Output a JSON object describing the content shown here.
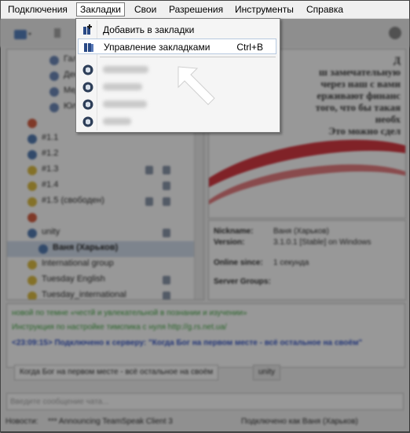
{
  "menubar": {
    "items": [
      {
        "label": "Подключения"
      },
      {
        "label": "Закладки"
      },
      {
        "label": "Свои"
      },
      {
        "label": "Разрешения"
      },
      {
        "label": "Инструменты"
      },
      {
        "label": "Справка"
      }
    ]
  },
  "bookmarks_menu": {
    "add_label": "Добавить в закладки",
    "manage_label": "Управление закладками",
    "manage_shortcut": "Ctrl+B"
  },
  "tree": {
    "rows": [
      {
        "label": "Гал"
      },
      {
        "label": "Ден"
      },
      {
        "label": "Мед"
      },
      {
        "label": "Юли"
      },
      {
        "label": ""
      },
      {
        "label": "#1.1"
      },
      {
        "label": "#1.2"
      },
      {
        "label": "#1.3"
      },
      {
        "label": "#1.4"
      },
      {
        "label": "#1.5 (свободен)"
      },
      {
        "label": ""
      },
      {
        "label": "unity"
      },
      {
        "label": "Ваня (Харьков)"
      },
      {
        "label": "International group"
      },
      {
        "label": "Tuesday English"
      },
      {
        "label": "Tuesday_international"
      }
    ]
  },
  "banner": {
    "lines": [
      "Д",
      "ш замечательную",
      "через наш с вами",
      "ерживают финанс",
      "того, что бы такая",
      "необх",
      "Это можно сдел"
    ]
  },
  "info": {
    "nickname_label": "Nickname:",
    "nickname_value": "Ваня (Харьков)",
    "version_label": "Version:",
    "version_value": "3.1.0.1 [Stable] on Windows",
    "online_label": "Online since:",
    "online_value": "1 секунда",
    "groups_label": "Server Groups:"
  },
  "chat": {
    "lines": [
      "новой по темне «честй и увлекательной в познании и изучении»",
      "Инструкция по настройке тимспика с нуля http://g.rs.net.ua/",
      "<23:09:15> Подключено к серверу: \"Когда Бог на первом месте - всё остальное на своём\""
    ],
    "tab1": "Когда Бог на первом месте - всё остальное на своём",
    "tab2": "unity",
    "input_placeholder": "Введите сообщение чата..."
  },
  "status": {
    "news_label": "Новости:",
    "news_text": "*** Announcing TeamSpeak Client 3",
    "connected_text": "Подключено как Ваня (Харьков)"
  },
  "colors": {
    "menu_hover_border": "#b7c9e0",
    "banner_red": "#d21d28",
    "link_blue": "#1a3fbf",
    "chat_green": "#2a9a2a"
  }
}
